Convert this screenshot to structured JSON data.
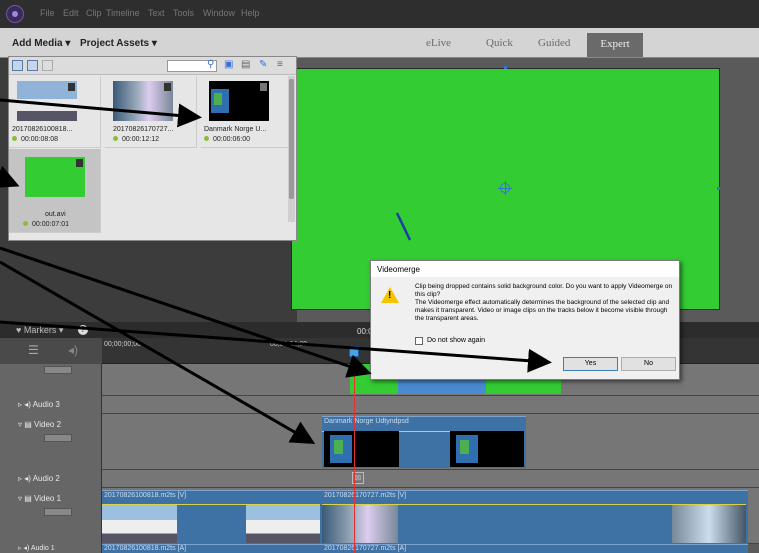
{
  "menu": [
    "File",
    "Edit",
    "Clip",
    "Timeline",
    "Text",
    "Tools",
    "Window",
    "Help"
  ],
  "subbar": {
    "add_media": "Add Media",
    "project_assets": "Project Assets"
  },
  "modes": {
    "elive": "eLive",
    "quick": "Quick",
    "guided": "Guided",
    "expert": "Expert"
  },
  "assets": [
    {
      "name": "20170826100818...",
      "duration": "00:00:08:08"
    },
    {
      "name": "20170826170727...",
      "duration": "00:00:12:12"
    },
    {
      "name": "Danmark Norge U...",
      "duration": "00:00:06:00"
    },
    {
      "name": "out.avi",
      "duration": "00:00:07:01"
    }
  ],
  "timeline": {
    "markers_label": "Markers",
    "timecode_center": "00:0",
    "ruler": [
      "00;00;00;00",
      "00;00;04;29"
    ],
    "tracks": {
      "audio3": "Audio 3",
      "video2": "Video 2",
      "audio2": "Audio 2",
      "video1": "Video 1",
      "audio1": "Audio 1"
    },
    "clips": {
      "video2": "Danmark Norge Udtyndpsd",
      "video1_a": "20170826100818.m2ts [V]",
      "video1_b": "20170826170727.m2ts [V]",
      "audio1_a": "20170826100818.m2ts [A]",
      "audio1_b": "20170826170727.m2ts [A]"
    }
  },
  "dialog": {
    "title": "Videomerge",
    "message": "Clip being dropped contains solid background color. Do you want to apply Videomerge on this clip?",
    "detail": "The Videomerge effect automatically determines the background of the selected clip and makes it transparent. Video or image clips on the tracks below it become visible through the transparent areas.",
    "checkbox": "Do not show again",
    "yes": "Yes",
    "no": "No"
  },
  "colors": {
    "preview": "#33cc33",
    "clip": "#3f72a4",
    "playhead": "#e53030",
    "warning": "#f5c400"
  }
}
